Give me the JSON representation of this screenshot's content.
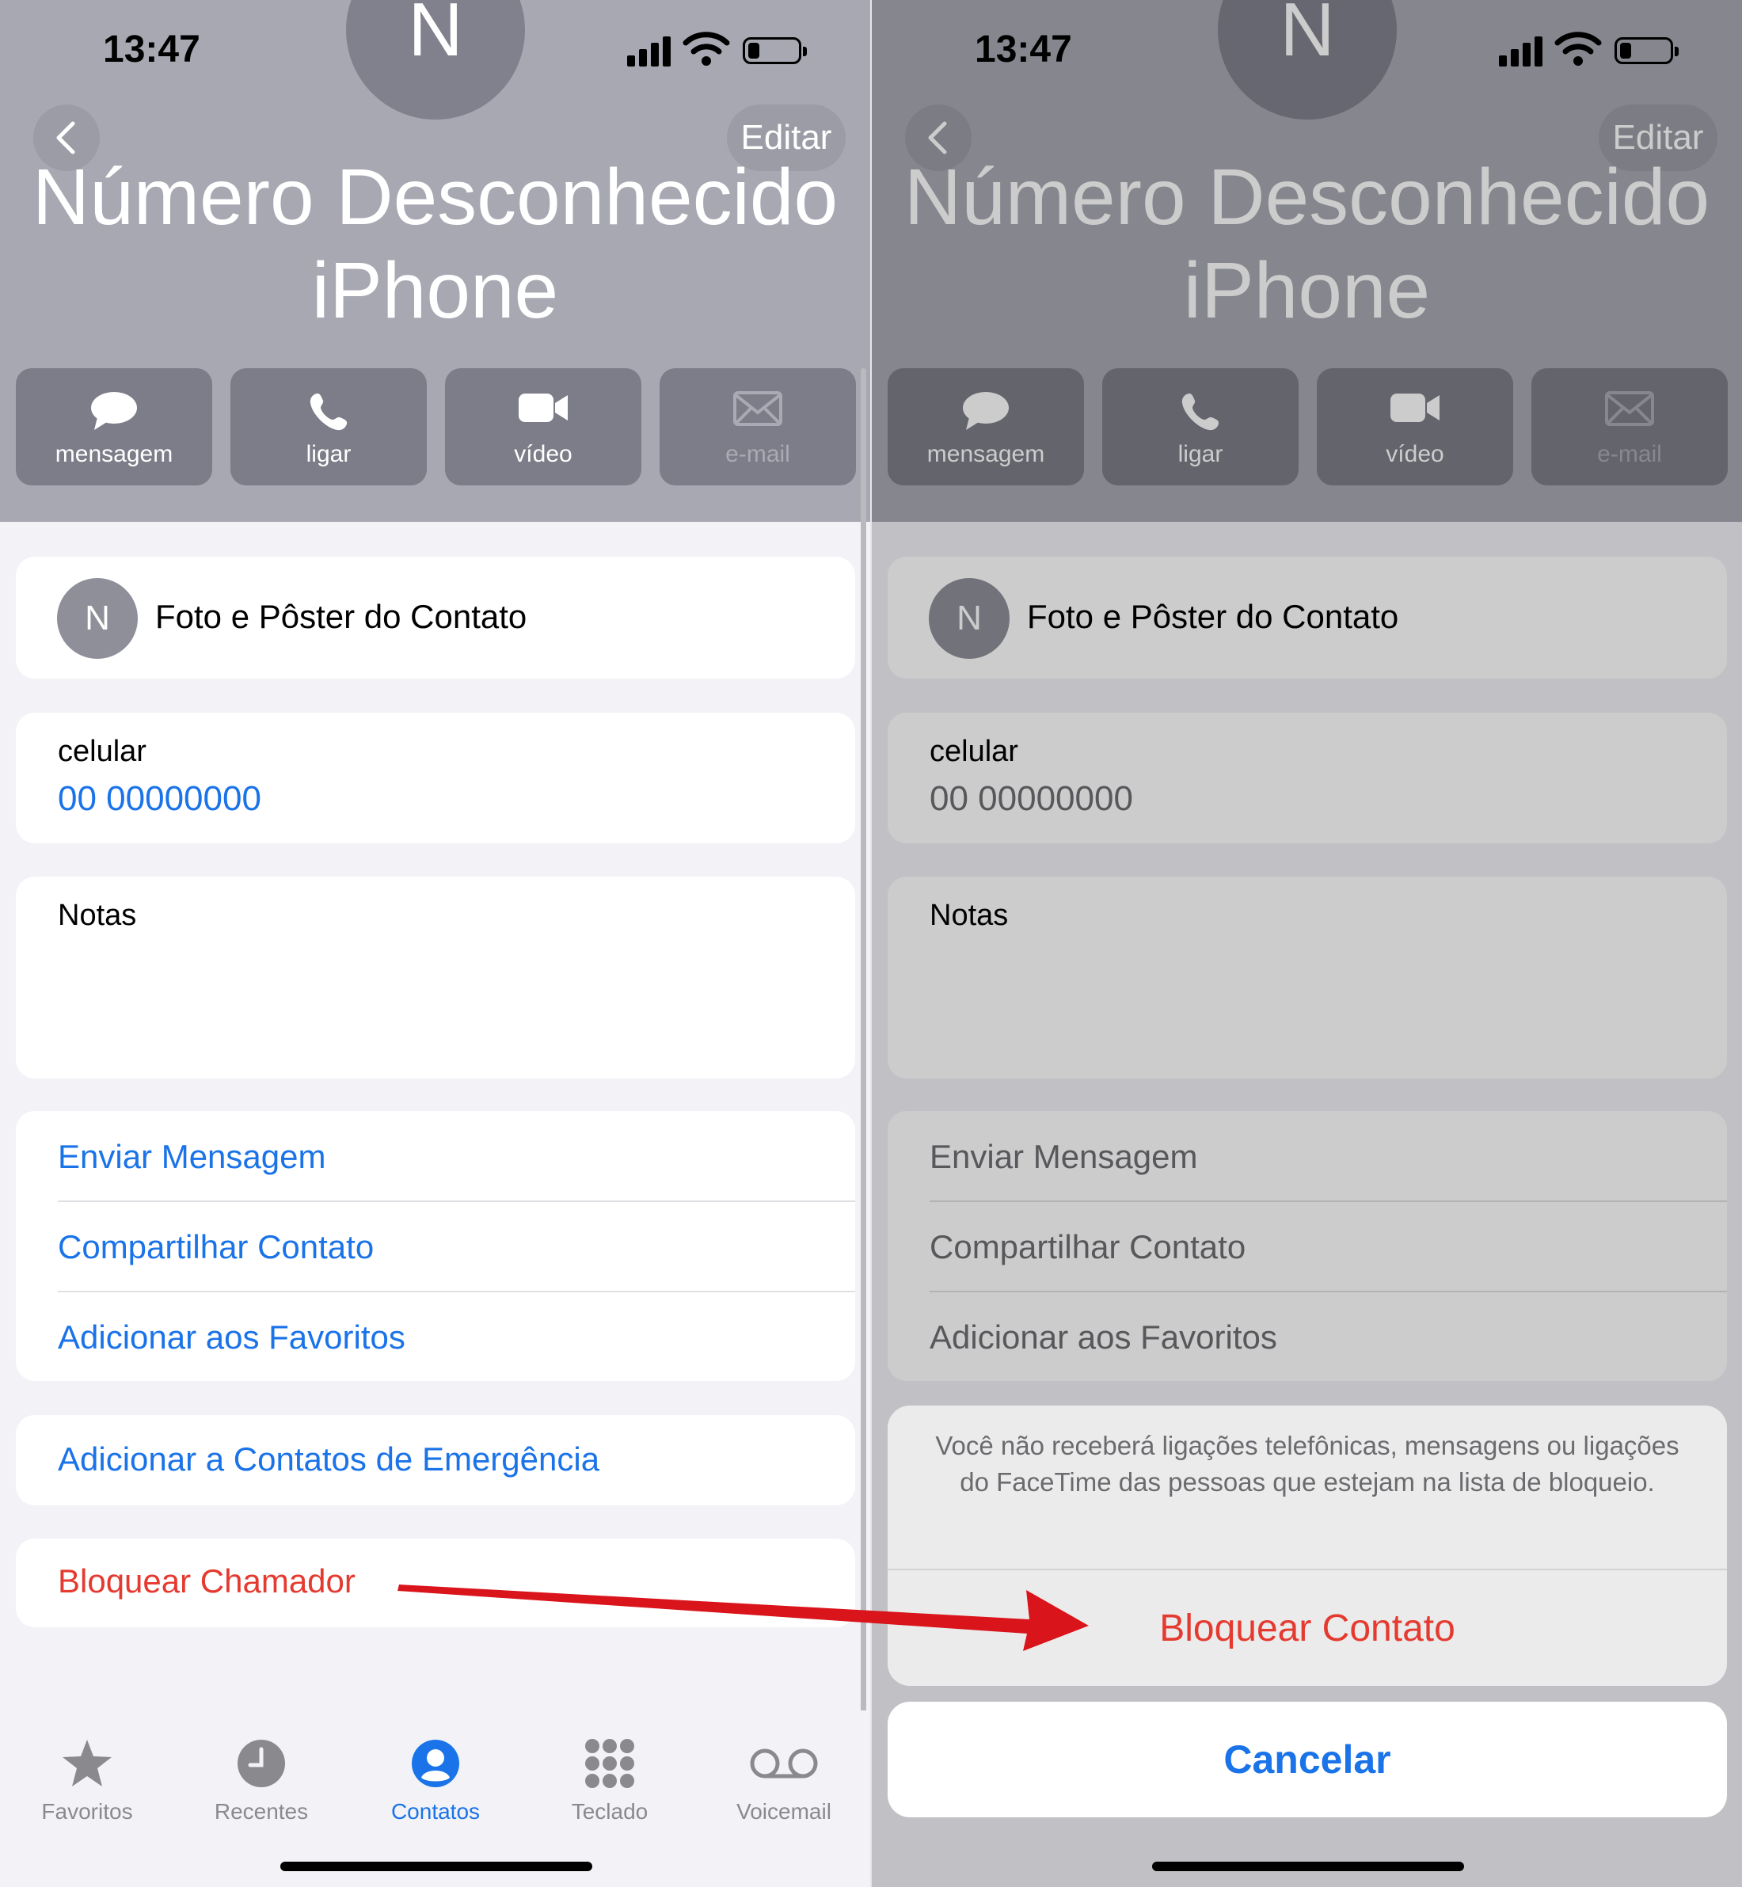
{
  "status": {
    "time": "13:47"
  },
  "contact": {
    "initial": "N",
    "name_line1": "Número Desconhecido",
    "name_line2": "iPhone"
  },
  "nav": {
    "edit_label": "Editar"
  },
  "actions": [
    {
      "label": "mensagem",
      "icon": "message-bubble-icon"
    },
    {
      "label": "ligar",
      "icon": "phone-icon"
    },
    {
      "label": "vídeo",
      "icon": "video-camera-icon"
    },
    {
      "label": "e-mail",
      "icon": "envelope-icon",
      "disabled": true
    }
  ],
  "photo_row": {
    "label": "Foto e Pôster do Contato"
  },
  "phone": {
    "type": "celular",
    "number": "00 00000000"
  },
  "notes": {
    "label": "Notas"
  },
  "options": [
    "Enviar Mensagem",
    "Compartilhar Contato",
    "Adicionar aos Favoritos"
  ],
  "emergency": {
    "label": "Adicionar a Contatos de Emergência"
  },
  "block": {
    "label": "Bloquear Chamador"
  },
  "tabs": [
    {
      "label": "Favoritos",
      "icon": "star-icon"
    },
    {
      "label": "Recentes",
      "icon": "clock-icon"
    },
    {
      "label": "Contatos",
      "icon": "person-circle-icon",
      "active": true
    },
    {
      "label": "Teclado",
      "icon": "keypad-icon"
    },
    {
      "label": "Voicemail",
      "icon": "voicemail-icon"
    }
  ],
  "action_sheet": {
    "message": "Você não receberá ligações telefônicas, mensagens ou ligações do FaceTime das pessoas que estejam na lista de bloqueio.",
    "confirm_label": "Bloquear Contato",
    "cancel_label": "Cancelar"
  },
  "colors": {
    "accent": "#1a73e8",
    "destructive": "#e53a2f",
    "arrow": "#d9141b"
  }
}
